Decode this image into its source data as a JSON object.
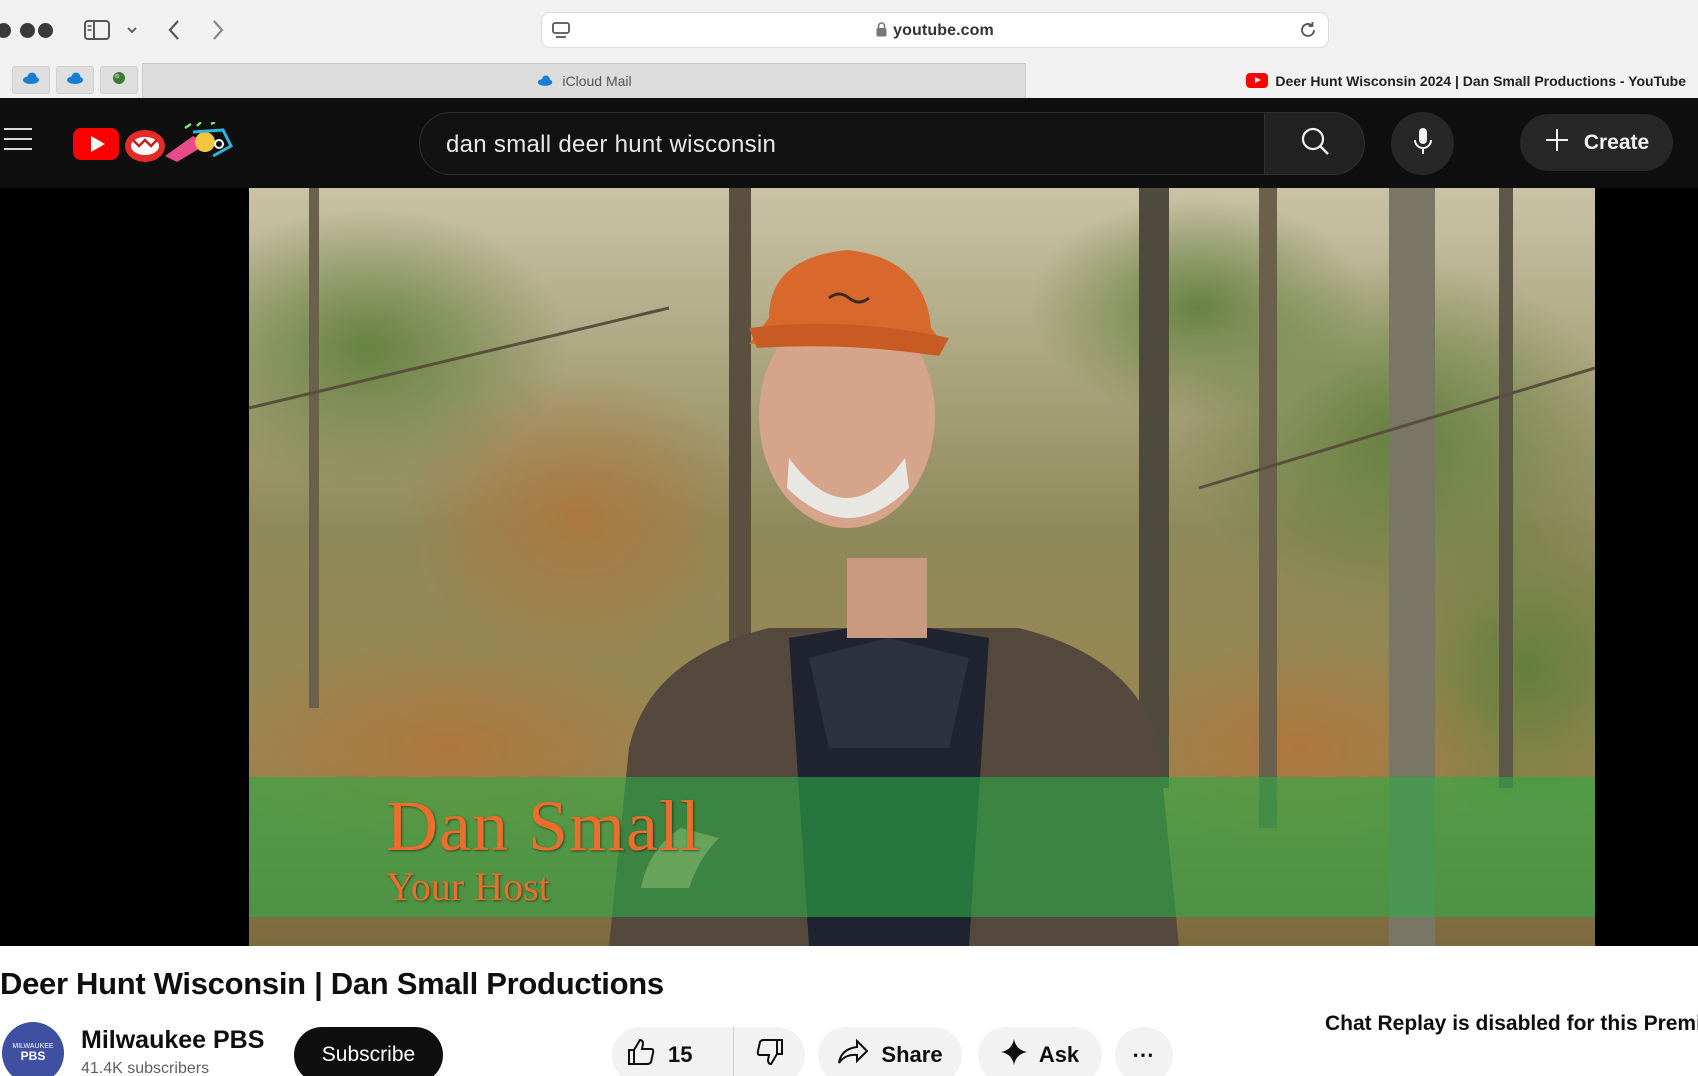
{
  "browser": {
    "url": "youtube.com",
    "tabs": [
      {
        "label": "iCloud Mail",
        "active": false
      },
      {
        "label": "Deer Hunt Wisconsin 2024 | Dan Small Productions - YouTube",
        "active": true
      }
    ]
  },
  "youtube": {
    "search_query": "dan small deer hunt wisconsin",
    "create_label": "Create"
  },
  "video": {
    "overlay_name": "Dan Small",
    "overlay_role": "Your Host",
    "title": "Deer Hunt Wisconsin | Dan Small Productions"
  },
  "channel": {
    "name": "Milwaukee PBS",
    "subscribers": "41.4K subscribers",
    "avatar_top": "MILWAUKEE",
    "avatar_bottom": "PBS",
    "subscribe_label": "Subscribe"
  },
  "actions": {
    "likes": "15",
    "share_label": "Share",
    "ask_label": "Ask",
    "more_label": "⋯"
  },
  "chat": {
    "note": "Chat Replay is disabled for this Premie"
  },
  "colors": {
    "youtube_red": "#ff0000",
    "header_bg": "#0f0f0f",
    "lower_third_green": "#2daa46",
    "caption_orange": "#ec6e2c"
  }
}
